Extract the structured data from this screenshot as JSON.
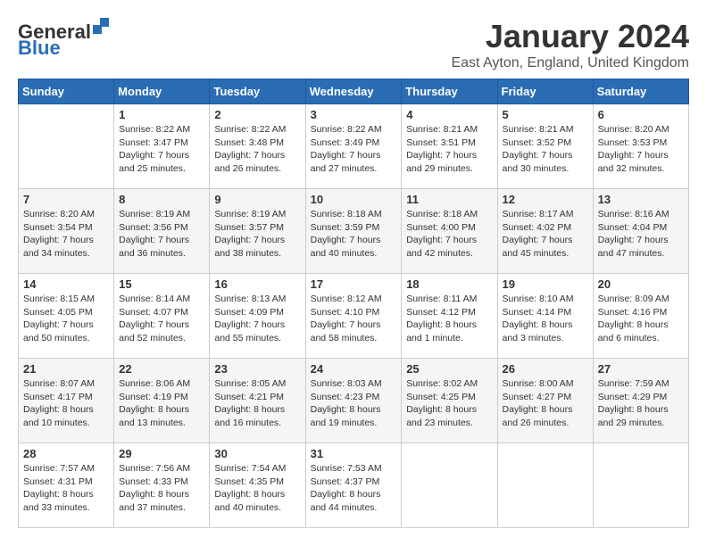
{
  "header": {
    "logo_general": "General",
    "logo_blue": "Blue",
    "title": "January 2024",
    "location": "East Ayton, England, United Kingdom"
  },
  "weekdays": [
    "Sunday",
    "Monday",
    "Tuesday",
    "Wednesday",
    "Thursday",
    "Friday",
    "Saturday"
  ],
  "weeks": [
    [
      {
        "day": "",
        "info": ""
      },
      {
        "day": "1",
        "info": "Sunrise: 8:22 AM\nSunset: 3:47 PM\nDaylight: 7 hours\nand 25 minutes."
      },
      {
        "day": "2",
        "info": "Sunrise: 8:22 AM\nSunset: 3:48 PM\nDaylight: 7 hours\nand 26 minutes."
      },
      {
        "day": "3",
        "info": "Sunrise: 8:22 AM\nSunset: 3:49 PM\nDaylight: 7 hours\nand 27 minutes."
      },
      {
        "day": "4",
        "info": "Sunrise: 8:21 AM\nSunset: 3:51 PM\nDaylight: 7 hours\nand 29 minutes."
      },
      {
        "day": "5",
        "info": "Sunrise: 8:21 AM\nSunset: 3:52 PM\nDaylight: 7 hours\nand 30 minutes."
      },
      {
        "day": "6",
        "info": "Sunrise: 8:20 AM\nSunset: 3:53 PM\nDaylight: 7 hours\nand 32 minutes."
      }
    ],
    [
      {
        "day": "7",
        "info": "Sunrise: 8:20 AM\nSunset: 3:54 PM\nDaylight: 7 hours\nand 34 minutes."
      },
      {
        "day": "8",
        "info": "Sunrise: 8:19 AM\nSunset: 3:56 PM\nDaylight: 7 hours\nand 36 minutes."
      },
      {
        "day": "9",
        "info": "Sunrise: 8:19 AM\nSunset: 3:57 PM\nDaylight: 7 hours\nand 38 minutes."
      },
      {
        "day": "10",
        "info": "Sunrise: 8:18 AM\nSunset: 3:59 PM\nDaylight: 7 hours\nand 40 minutes."
      },
      {
        "day": "11",
        "info": "Sunrise: 8:18 AM\nSunset: 4:00 PM\nDaylight: 7 hours\nand 42 minutes."
      },
      {
        "day": "12",
        "info": "Sunrise: 8:17 AM\nSunset: 4:02 PM\nDaylight: 7 hours\nand 45 minutes."
      },
      {
        "day": "13",
        "info": "Sunrise: 8:16 AM\nSunset: 4:04 PM\nDaylight: 7 hours\nand 47 minutes."
      }
    ],
    [
      {
        "day": "14",
        "info": "Sunrise: 8:15 AM\nSunset: 4:05 PM\nDaylight: 7 hours\nand 50 minutes."
      },
      {
        "day": "15",
        "info": "Sunrise: 8:14 AM\nSunset: 4:07 PM\nDaylight: 7 hours\nand 52 minutes."
      },
      {
        "day": "16",
        "info": "Sunrise: 8:13 AM\nSunset: 4:09 PM\nDaylight: 7 hours\nand 55 minutes."
      },
      {
        "day": "17",
        "info": "Sunrise: 8:12 AM\nSunset: 4:10 PM\nDaylight: 7 hours\nand 58 minutes."
      },
      {
        "day": "18",
        "info": "Sunrise: 8:11 AM\nSunset: 4:12 PM\nDaylight: 8 hours\nand 1 minute."
      },
      {
        "day": "19",
        "info": "Sunrise: 8:10 AM\nSunset: 4:14 PM\nDaylight: 8 hours\nand 3 minutes."
      },
      {
        "day": "20",
        "info": "Sunrise: 8:09 AM\nSunset: 4:16 PM\nDaylight: 8 hours\nand 6 minutes."
      }
    ],
    [
      {
        "day": "21",
        "info": "Sunrise: 8:07 AM\nSunset: 4:17 PM\nDaylight: 8 hours\nand 10 minutes."
      },
      {
        "day": "22",
        "info": "Sunrise: 8:06 AM\nSunset: 4:19 PM\nDaylight: 8 hours\nand 13 minutes."
      },
      {
        "day": "23",
        "info": "Sunrise: 8:05 AM\nSunset: 4:21 PM\nDaylight: 8 hours\nand 16 minutes."
      },
      {
        "day": "24",
        "info": "Sunrise: 8:03 AM\nSunset: 4:23 PM\nDaylight: 8 hours\nand 19 minutes."
      },
      {
        "day": "25",
        "info": "Sunrise: 8:02 AM\nSunset: 4:25 PM\nDaylight: 8 hours\nand 23 minutes."
      },
      {
        "day": "26",
        "info": "Sunrise: 8:00 AM\nSunset: 4:27 PM\nDaylight: 8 hours\nand 26 minutes."
      },
      {
        "day": "27",
        "info": "Sunrise: 7:59 AM\nSunset: 4:29 PM\nDaylight: 8 hours\nand 29 minutes."
      }
    ],
    [
      {
        "day": "28",
        "info": "Sunrise: 7:57 AM\nSunset: 4:31 PM\nDaylight: 8 hours\nand 33 minutes."
      },
      {
        "day": "29",
        "info": "Sunrise: 7:56 AM\nSunset: 4:33 PM\nDaylight: 8 hours\nand 37 minutes."
      },
      {
        "day": "30",
        "info": "Sunrise: 7:54 AM\nSunset: 4:35 PM\nDaylight: 8 hours\nand 40 minutes."
      },
      {
        "day": "31",
        "info": "Sunrise: 7:53 AM\nSunset: 4:37 PM\nDaylight: 8 hours\nand 44 minutes."
      },
      {
        "day": "",
        "info": ""
      },
      {
        "day": "",
        "info": ""
      },
      {
        "day": "",
        "info": ""
      }
    ]
  ]
}
